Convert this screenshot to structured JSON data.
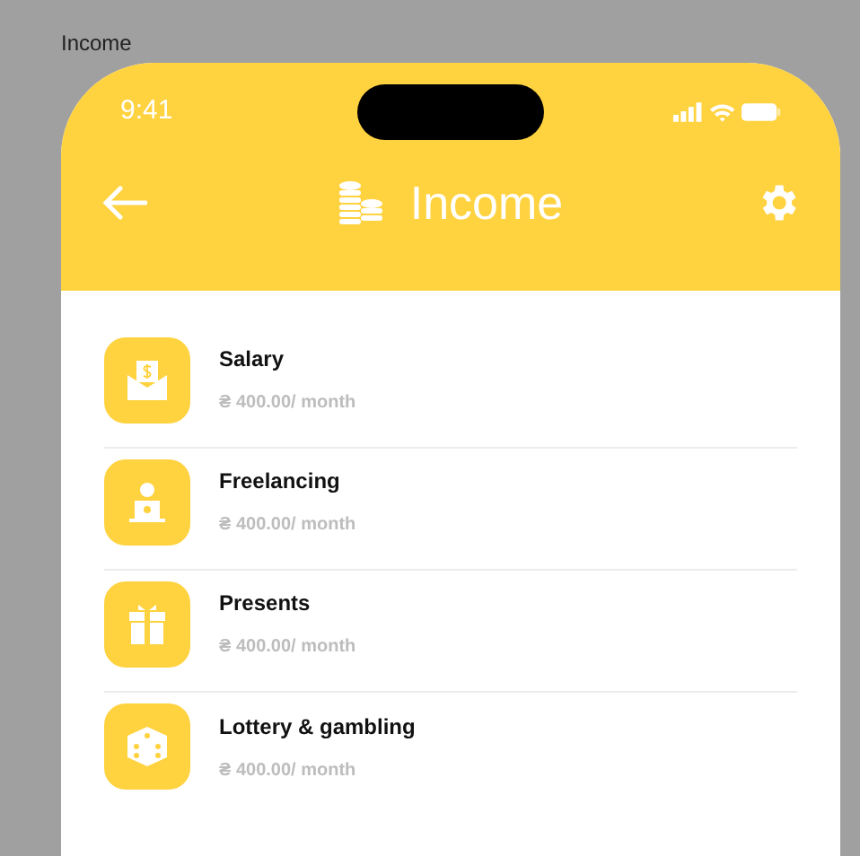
{
  "frame_label": "Income",
  "status_bar": {
    "time": "9:41"
  },
  "header": {
    "title": "Income"
  },
  "items": [
    {
      "kind": "salary",
      "name": "Salary",
      "amount": "₴ 400.00/ month"
    },
    {
      "kind": "freelance",
      "name": "Freelancing",
      "amount": "₴ 400.00/ month"
    },
    {
      "kind": "gift",
      "name": "Presents",
      "amount": "₴ 400.00/ month"
    },
    {
      "kind": "dice",
      "name": "Lottery & gambling",
      "amount": "₴ 400.00/ month"
    }
  ]
}
